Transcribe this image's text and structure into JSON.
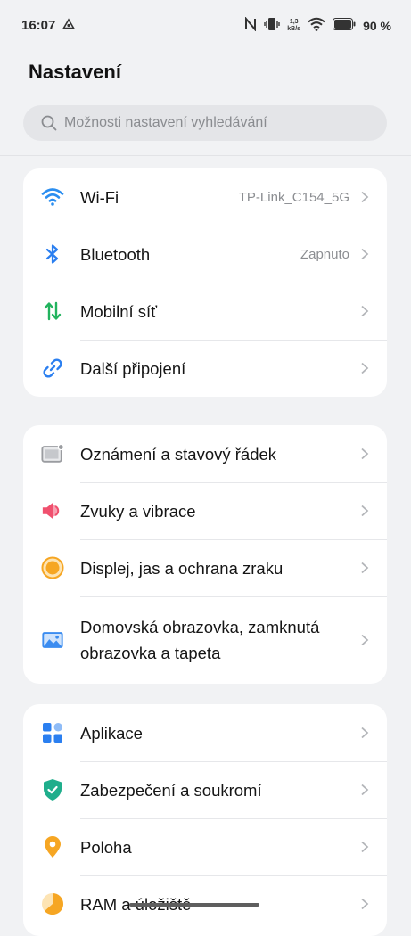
{
  "status_bar": {
    "time": "16:07",
    "speed_value": "1,3",
    "speed_unit": "kB/s",
    "battery_percent": "90 %",
    "icons": [
      "sync-icon",
      "nfc-icon",
      "vibrate-icon",
      "wifi-icon",
      "battery-icon"
    ]
  },
  "header": {
    "title": "Nastavení"
  },
  "search": {
    "placeholder": "Možnosti nastavení vyhledávání"
  },
  "groups": [
    {
      "items": [
        {
          "label": "Wi-Fi",
          "value": "TP-Link_C154_5G",
          "icon": "wifi-icon",
          "color": "#2b8ef0"
        },
        {
          "label": "Bluetooth",
          "value": "Zapnuto",
          "icon": "bluetooth-icon",
          "color": "#2b7ff0"
        },
        {
          "label": "Mobilní síť",
          "value": "",
          "icon": "mobile-data-icon",
          "color": "#22b35e"
        },
        {
          "label": "Další připojení",
          "value": "",
          "icon": "link-icon",
          "color": "#2b7ff0"
        }
      ]
    },
    {
      "items": [
        {
          "label": "Oznámení a stavový řádek",
          "icon": "notification-icon",
          "color": "#9a9ca0"
        },
        {
          "label": "Zvuky a vibrace",
          "icon": "sound-icon",
          "color": "#f0506e"
        },
        {
          "label": "Displej, jas a ochrana zraku",
          "icon": "display-icon",
          "color": "#f6a623"
        },
        {
          "label_line1": "Domovská obrazovka, zamknutá",
          "label_line2": "obrazovka a tapeta",
          "icon": "wallpaper-icon",
          "color": "#3b8cf0"
        }
      ]
    },
    {
      "items": [
        {
          "label": "Aplikace",
          "icon": "apps-icon",
          "color": "#2b7ff0"
        },
        {
          "label": "Zabezpečení a soukromí",
          "icon": "shield-icon",
          "color": "#1fae8c"
        },
        {
          "label": "Poloha",
          "icon": "location-icon",
          "color": "#f6a623"
        },
        {
          "label": "RAM a úložiště",
          "icon": "storage-icon",
          "color": "#f6a623"
        }
      ]
    }
  ]
}
